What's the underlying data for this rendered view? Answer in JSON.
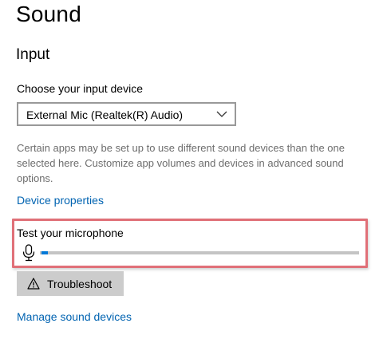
{
  "header": {
    "title": "Sound"
  },
  "input_section": {
    "title": "Input",
    "device_label": "Choose your input device",
    "device_dropdown": {
      "selected": "External Mic (Realtek(R) Audio)"
    },
    "help_text": "Certain apps may be set up to use different sound devices than the one selected here. Customize app volumes and devices in advanced sound options.",
    "device_properties_link": "Device properties",
    "test_microphone": {
      "label": "Test your microphone",
      "level_fraction": 0.02
    },
    "troubleshoot_label": "Troubleshoot",
    "manage_devices_link": "Manage sound devices"
  },
  "icons": {
    "dropdown": "chevron-down-icon",
    "microphone": "microphone-icon",
    "troubleshoot": "warning-icon"
  },
  "colors": {
    "link": "#0063b1",
    "level_fill": "#0078d7",
    "highlight_border": "#e07078",
    "button_bg": "#cccccc"
  }
}
